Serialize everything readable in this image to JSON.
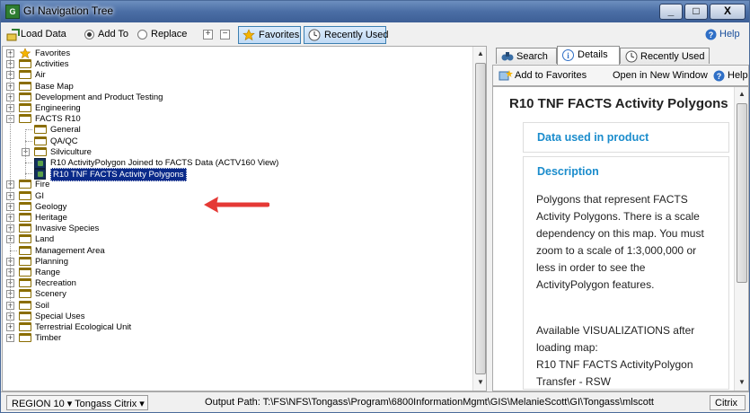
{
  "window": {
    "title": "GI Navigation Tree",
    "icon": "gi-app-icon",
    "minimize": "_",
    "maximize": "□",
    "close": "X"
  },
  "toolbar": {
    "load_data": "Load Data",
    "add_to": "Add To",
    "replace": "Replace",
    "favorites": "Favorites",
    "recently_used": "Recently Used",
    "help": "Help",
    "selected_mode": "Add To"
  },
  "tree": {
    "items": [
      "Favorites",
      "Activities",
      "Air",
      "Base Map",
      "Development and Product Testing",
      "Engineering",
      "FACTS R10",
      "General",
      "QA/QC",
      "Silviculture",
      "R10 ActivityPolygon Joined to FACTS Data (ACTV160 View)",
      "R10 TNF FACTS Activity Polygons",
      "Fire",
      "GI",
      "Geology",
      "Heritage",
      "Invasive Species",
      "Land",
      "Management Area",
      "Planning",
      "Range",
      "Recreation",
      "Scenery",
      "Soil",
      "Special Uses",
      "Terrestrial Ecological Unit",
      "Timber"
    ],
    "selected": "R10 TNF FACTS Activity Polygons"
  },
  "right": {
    "tabs": [
      "Search",
      "Details",
      "Recently Used"
    ],
    "active_tab": "Details",
    "add_to_favorites": "Add to Favorites",
    "open_new_window": "Open in New Window",
    "help": "Help",
    "title": "R10 TNF FACTS Activity Polygons",
    "section1": "Data used in product",
    "section2": "Description",
    "description": "Polygons that represent FACTS Activity Polygons. There is a scale dependency on this map. You must zoom to a scale of 1:3,000,000 or less in order to see the ActivityPolygon features.",
    "viz_intro": "Available VISUALIZATIONS after loading map:",
    "viz_item": "R10 TNF FACTS ActivityPolygon Transfer - RSW"
  },
  "status": {
    "region": "REGION 10",
    "location": "Tongass Citrix",
    "output_path": "Output Path: T:\\FS\\NFS\\Tongass\\Program\\6800InformationMgmt\\GIS\\MelanieScott\\GI\\Tongass\\mlscott",
    "citrix": "Citrix"
  },
  "colors": {
    "titlebar": "#4b6ea5",
    "selection": "#0a2a8a",
    "accent_blue": "#1a8ccc",
    "annotation_arrow": "#e53935"
  }
}
